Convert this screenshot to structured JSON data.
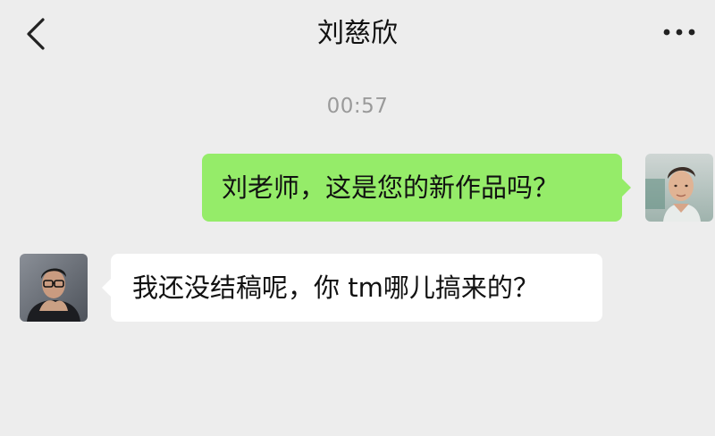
{
  "header": {
    "back_icon": "chevron-left-icon",
    "title": "刘慈欣",
    "more_icon": "ellipsis-icon"
  },
  "chat": {
    "timestamp": "00:57",
    "messages": [
      {
        "direction": "outgoing",
        "text": "刘老师，这是您的新作品吗？",
        "bubble_color": "#95ec69"
      },
      {
        "direction": "incoming",
        "text": "我还没结稿呢，你 tm哪儿搞来的？",
        "bubble_color": "#ffffff"
      }
    ]
  },
  "colors": {
    "background": "#ededed",
    "outgoing_bubble": "#95ec69",
    "incoming_bubble": "#ffffff",
    "timestamp_text": "#9a9a9a"
  }
}
